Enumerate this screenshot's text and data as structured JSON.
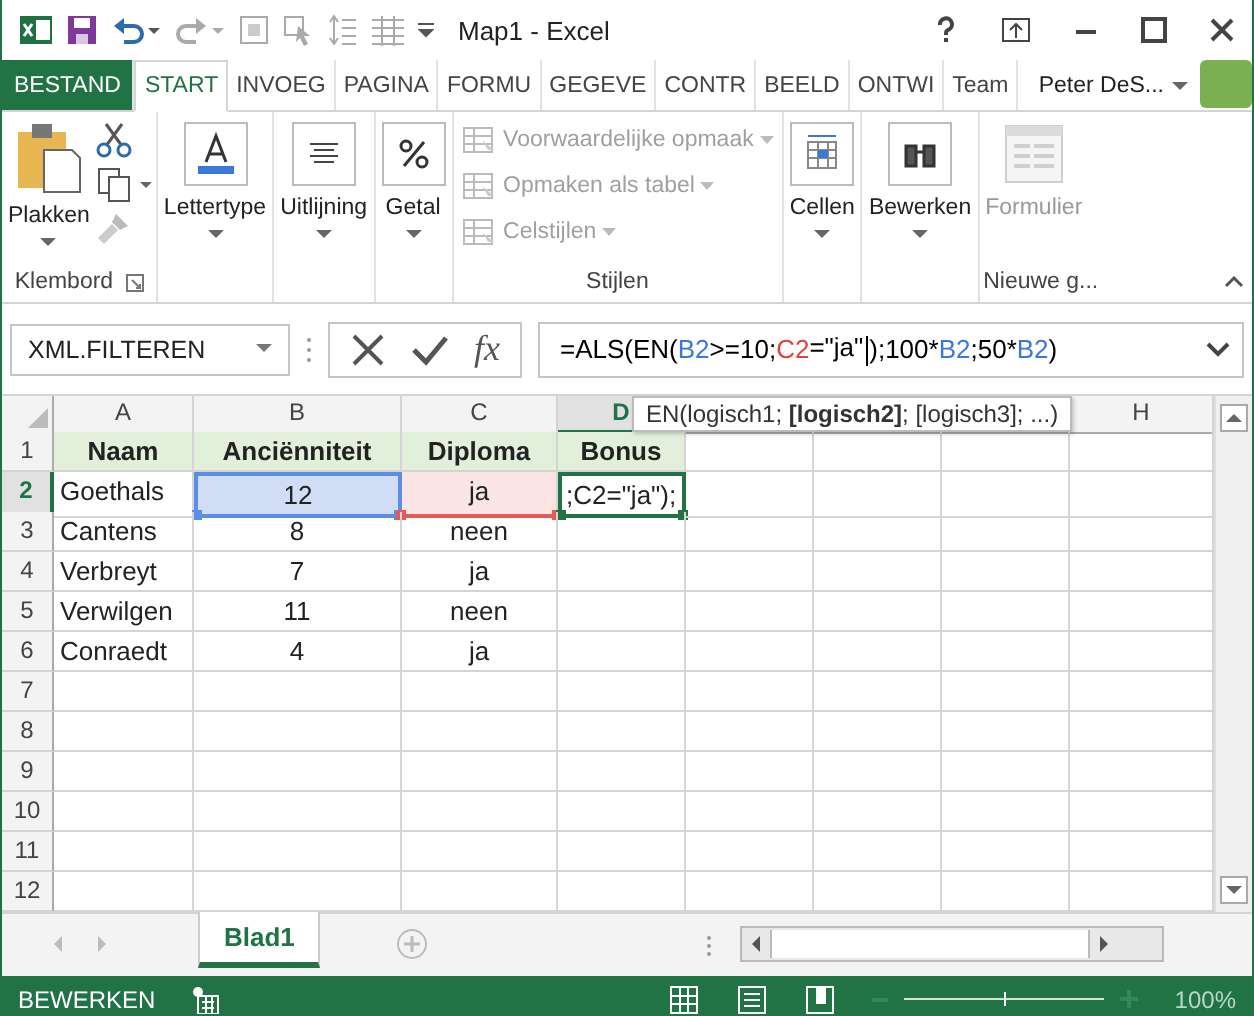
{
  "window": {
    "title": "Map1 - Excel"
  },
  "tabs": [
    {
      "label": "BESTAND",
      "kind": "file",
      "selected": false
    },
    {
      "label": "START",
      "kind": "tab",
      "selected": true
    },
    {
      "label": "INVOEG",
      "kind": "tab",
      "selected": false
    },
    {
      "label": "PAGINA",
      "kind": "tab",
      "selected": false
    },
    {
      "label": "FORMU",
      "kind": "tab",
      "selected": false
    },
    {
      "label": "GEGEVE",
      "kind": "tab",
      "selected": false
    },
    {
      "label": "CONTR",
      "kind": "tab",
      "selected": false
    },
    {
      "label": "BEELD",
      "kind": "tab",
      "selected": false
    },
    {
      "label": "ONTWI",
      "kind": "tab",
      "selected": false
    },
    {
      "label": "Team",
      "kind": "tab",
      "selected": false
    }
  ],
  "user": {
    "name": "Peter DeS..."
  },
  "ribbon": {
    "clipboard": {
      "paste": "Plakken",
      "label": "Klembord"
    },
    "big_buttons": [
      {
        "label": "Lettertype",
        "disabled": false
      },
      {
        "label": "Uitlijning",
        "disabled": false
      },
      {
        "label": "Getal",
        "disabled": false
      }
    ],
    "styles": {
      "items": [
        {
          "label": "Voorwaardelijke opmaak",
          "disabled": true
        },
        {
          "label": "Opmaken als tabel",
          "disabled": true
        },
        {
          "label": "Celstijlen",
          "disabled": true
        }
      ],
      "label": "Stijlen"
    },
    "big_buttons_2": [
      {
        "label": "Cellen",
        "disabled": false
      },
      {
        "label": "Bewerken",
        "disabled": false
      }
    ],
    "new_group": {
      "button": "Formulier",
      "disabled": true,
      "label": "Nieuwe g..."
    }
  },
  "formula_bar": {
    "name_box": "XML.FILTEREN",
    "fx": "fx",
    "segments": [
      {
        "text": "=ALS(EN(",
        "color": "#000000",
        "caret_after": false
      },
      {
        "text": "B2",
        "color": "#3c78d8",
        "caret_after": false
      },
      {
        "text": ">=10;",
        "color": "#000000",
        "caret_after": false
      },
      {
        "text": "C2",
        "color": "#e0433b",
        "caret_after": false
      },
      {
        "text": "=\"ja\"",
        "color": "#000000",
        "caret_after": true
      },
      {
        "text": ");100*",
        "color": "#000000",
        "caret_after": false
      },
      {
        "text": "B2",
        "color": "#3c78d8",
        "caret_after": false
      },
      {
        "text": ";50*",
        "color": "#000000",
        "caret_after": false
      },
      {
        "text": "B2",
        "color": "#3c78d8",
        "caret_after": false
      },
      {
        "text": ")",
        "color": "#000000",
        "caret_after": false
      }
    ]
  },
  "tooltip": "EN(logisch1; **[logisch2]**; [logisch3]; ...)",
  "sheet": {
    "columns": [
      {
        "label": "A",
        "selected": false
      },
      {
        "label": "B",
        "selected": false
      },
      {
        "label": "C",
        "selected": false
      },
      {
        "label": "D",
        "selected": true
      },
      {},
      {},
      {},
      {
        "label": "H",
        "selected": false
      }
    ],
    "rows": [
      {
        "header": "1",
        "selected": false,
        "kind": "table-header",
        "cells": [
          {
            "text": "Naam",
            "kind": "plain"
          },
          {
            "text": "Anciënniteit",
            "kind": "plain"
          },
          {
            "text": "Diploma",
            "kind": "plain"
          },
          {
            "text": "Bonus",
            "kind": "plain"
          }
        ]
      },
      {
        "header": "2",
        "selected": true,
        "kind": "data",
        "cells": [
          {
            "text": "Goethals",
            "kind": "plain"
          },
          {
            "text": "12",
            "kind": "blue"
          },
          {
            "text": "ja",
            "kind": "red"
          },
          {
            "text": ";C2=\"ja\");",
            "kind": "edit"
          }
        ]
      },
      {
        "header": "3",
        "selected": false,
        "kind": "data",
        "cells": [
          {
            "text": "Cantens",
            "kind": "plain"
          },
          {
            "text": "8",
            "kind": "plain"
          },
          {
            "text": "neen",
            "kind": "plain"
          }
        ]
      },
      {
        "header": "4",
        "selected": false,
        "kind": "data",
        "cells": [
          {
            "text": "Verbreyt",
            "kind": "plain"
          },
          {
            "text": "7",
            "kind": "plain"
          },
          {
            "text": "ja",
            "kind": "plain"
          }
        ]
      },
      {
        "header": "5",
        "selected": false,
        "kind": "data",
        "cells": [
          {
            "text": "Verwilgen",
            "kind": "plain"
          },
          {
            "text": "11",
            "kind": "plain"
          },
          {
            "text": "neen",
            "kind": "plain"
          }
        ]
      },
      {
        "header": "6",
        "selected": false,
        "kind": "data",
        "cells": [
          {
            "text": "Conraedt",
            "kind": "plain"
          },
          {
            "text": "4",
            "kind": "plain"
          },
          {
            "text": "ja",
            "kind": "plain"
          }
        ]
      },
      {
        "header": "7",
        "selected": false,
        "kind": "data",
        "cells": []
      },
      {
        "header": "8",
        "selected": false,
        "kind": "data",
        "cells": []
      },
      {
        "header": "9",
        "selected": false,
        "kind": "data",
        "cells": []
      },
      {
        "header": "10",
        "selected": false,
        "kind": "data",
        "cells": []
      },
      {
        "header": "11",
        "selected": false,
        "kind": "data",
        "cells": []
      },
      {
        "header": "12",
        "selected": false,
        "kind": "data",
        "cells": []
      }
    ]
  },
  "sheet_tabs": [
    {
      "label": "Blad1",
      "selected": true
    }
  ],
  "status_bar": {
    "mode": "BEWERKEN",
    "zoom": {
      "level": 0.5,
      "reading": "100%"
    }
  }
}
